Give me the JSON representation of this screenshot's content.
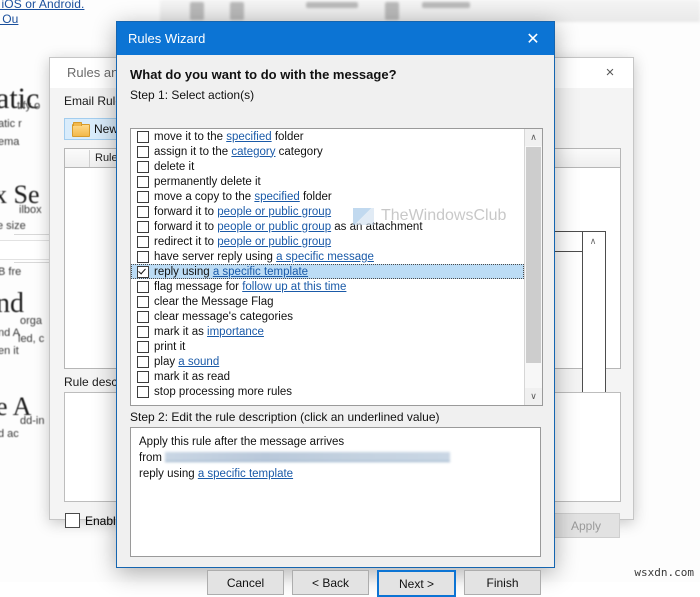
{
  "backdrop": {
    "links": [
      {
        "text": "r iOS or Android."
      },
      {
        "text": "e Ou"
      }
    ],
    "headings": [
      {
        "text": "atic"
      },
      {
        "text": "x Se"
      },
      {
        "text": "nd"
      },
      {
        "text": "e A"
      }
    ],
    "fragments": [
      {
        "text": "tify o"
      },
      {
        "text": "atic r"
      },
      {
        "text": "ema"
      },
      {
        "text": "ilbox"
      },
      {
        "text": "e size"
      },
      {
        "text": "B fre"
      },
      {
        "text": "orga"
      },
      {
        "text": "nd A"
      },
      {
        "text": "led, c"
      },
      {
        "text": "en it"
      },
      {
        "text": "dd-in"
      },
      {
        "text": "d ac"
      }
    ]
  },
  "rules_alerts_window": {
    "title": "Rules and A",
    "close_icon": "×",
    "tab_label": "Email Rule",
    "new_rule_button": "New R",
    "list_column_header": "Rule (",
    "rule_description_label": "Rule descr",
    "enable_checkbox_label": "Enable",
    "enable_checked": false,
    "apply_button": "Apply",
    "apply_disabled": true,
    "scroll_up_icon": "∧",
    "scroll_down_icon": "∨"
  },
  "wizard": {
    "title": "Rules Wizard",
    "close_icon": "✕",
    "question": "What do you want to do with the message?",
    "step1_label": "Step 1: Select action(s)",
    "step2_label": "Step 2: Edit the rule description (click an underlined value)",
    "accent_color": "#0c74d4",
    "selection_color": "#bcdcf5",
    "link_color": "#1a5aa8",
    "scroll_up_icon": "∧",
    "scroll_down_icon": "∨",
    "actions": [
      {
        "checked": false,
        "selected": false,
        "parts": [
          {
            "t": "move it to the ",
            "link": false
          },
          {
            "t": "specified",
            "link": true
          },
          {
            "t": " folder",
            "link": false
          }
        ]
      },
      {
        "checked": false,
        "selected": false,
        "parts": [
          {
            "t": "assign it to the ",
            "link": false
          },
          {
            "t": "category",
            "link": true
          },
          {
            "t": " category",
            "link": false
          }
        ]
      },
      {
        "checked": false,
        "selected": false,
        "parts": [
          {
            "t": "delete it",
            "link": false
          }
        ]
      },
      {
        "checked": false,
        "selected": false,
        "parts": [
          {
            "t": "permanently delete it",
            "link": false
          }
        ]
      },
      {
        "checked": false,
        "selected": false,
        "parts": [
          {
            "t": "move a copy to the ",
            "link": false
          },
          {
            "t": "specified",
            "link": true
          },
          {
            "t": " folder",
            "link": false
          }
        ]
      },
      {
        "checked": false,
        "selected": false,
        "parts": [
          {
            "t": "forward it to ",
            "link": false
          },
          {
            "t": "people or public group",
            "link": true
          }
        ]
      },
      {
        "checked": false,
        "selected": false,
        "parts": [
          {
            "t": "forward it to ",
            "link": false
          },
          {
            "t": "people or public group",
            "link": true
          },
          {
            "t": " as an attachment",
            "link": false
          }
        ]
      },
      {
        "checked": false,
        "selected": false,
        "parts": [
          {
            "t": "redirect it to ",
            "link": false
          },
          {
            "t": "people or public group",
            "link": true
          }
        ]
      },
      {
        "checked": false,
        "selected": false,
        "parts": [
          {
            "t": "have server reply using ",
            "link": false
          },
          {
            "t": "a specific message",
            "link": true
          }
        ]
      },
      {
        "checked": true,
        "selected": true,
        "parts": [
          {
            "t": "reply using ",
            "link": false
          },
          {
            "t": "a specific template",
            "link": true
          }
        ]
      },
      {
        "checked": false,
        "selected": false,
        "parts": [
          {
            "t": "flag message for ",
            "link": false
          },
          {
            "t": "follow up at this time",
            "link": true
          }
        ]
      },
      {
        "checked": false,
        "selected": false,
        "parts": [
          {
            "t": "clear the Message Flag",
            "link": false
          }
        ]
      },
      {
        "checked": false,
        "selected": false,
        "parts": [
          {
            "t": "clear message's categories",
            "link": false
          }
        ]
      },
      {
        "checked": false,
        "selected": false,
        "parts": [
          {
            "t": "mark it as ",
            "link": false
          },
          {
            "t": "importance",
            "link": true
          }
        ]
      },
      {
        "checked": false,
        "selected": false,
        "parts": [
          {
            "t": "print it",
            "link": false
          }
        ]
      },
      {
        "checked": false,
        "selected": false,
        "parts": [
          {
            "t": "play ",
            "link": false
          },
          {
            "t": "a sound",
            "link": true
          }
        ]
      },
      {
        "checked": false,
        "selected": false,
        "parts": [
          {
            "t": "mark it as read",
            "link": false
          }
        ]
      },
      {
        "checked": false,
        "selected": false,
        "parts": [
          {
            "t": "stop processing more rules",
            "link": false
          }
        ]
      }
    ],
    "description_lines": [
      {
        "type": "text",
        "text": "Apply this rule after the message arrives"
      },
      {
        "type": "redacted",
        "prefix": "from ",
        "value": ""
      },
      {
        "type": "link",
        "prefix": "reply using ",
        "link_text": "a specific template"
      }
    ],
    "buttons": [
      {
        "label": "Cancel",
        "primary": false
      },
      {
        "label": "< Back",
        "primary": false
      },
      {
        "label": "Next >",
        "primary": true
      },
      {
        "label": "Finish",
        "primary": false
      }
    ]
  },
  "watermarks": {
    "brand": "TheWindowsClub",
    "footer": "wsxdn.com"
  }
}
